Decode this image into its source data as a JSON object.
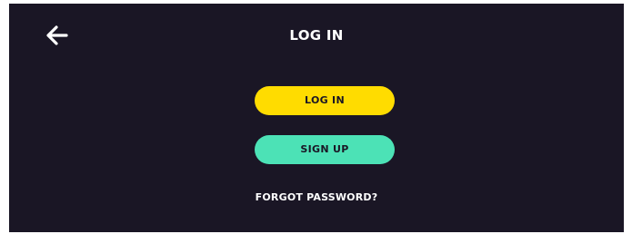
{
  "header": {
    "back_icon": "arrow-left-icon",
    "title": "LOG IN"
  },
  "actions": {
    "login_label": "LOG IN",
    "signup_label": "SIGN UP",
    "forgot_label": "FORGOT PASSWORD?"
  },
  "colors": {
    "background": "#1a1625",
    "login_button": "#ffdc00",
    "signup_button": "#4ce2b6",
    "text": "#ffffff"
  }
}
